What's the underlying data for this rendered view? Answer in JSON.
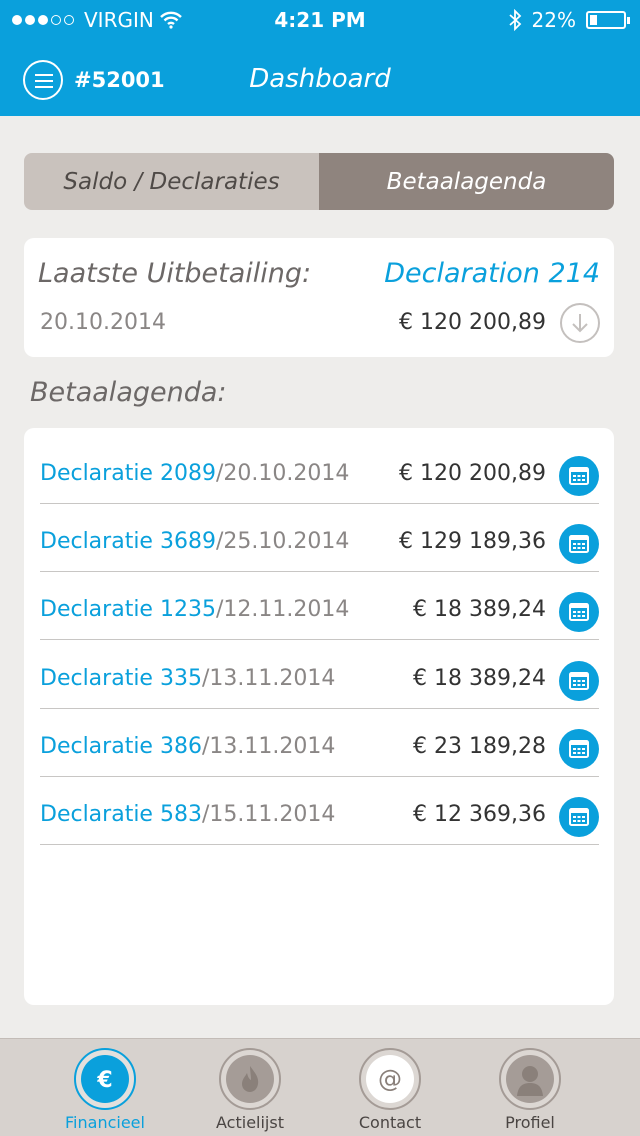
{
  "status_bar": {
    "carrier": "VIRGIN",
    "time": "4:21 PM",
    "battery": "22%"
  },
  "header": {
    "account_id": "#52001",
    "title": "Dashboard"
  },
  "segment": {
    "tab1": "Saldo / Declaraties",
    "tab2": "Betaalagenda",
    "active": "Betaalagenda"
  },
  "last_payout": {
    "label": "Laatste Uitbetailing:",
    "link": "Declaration 214",
    "date": "20.10.2014",
    "amount": "€ 120 200,89"
  },
  "section_heading": "Betaalagenda:",
  "payments": [
    {
      "name": "Declaratie 2089",
      "date": "/20.10.2014",
      "amount": "€ 120 200,89"
    },
    {
      "name": "Declaratie 3689",
      "date": "/25.10.2014",
      "amount": "€ 129 189,36"
    },
    {
      "name": "Declaratie 1235",
      "date": "/12.11.2014",
      "amount": "€ 18 389,24"
    },
    {
      "name": "Declaratie 335",
      "date": "/13.11.2014",
      "amount": "€ 18 389,24"
    },
    {
      "name": "Declaratie 386",
      "date": "/13.11.2014",
      "amount": "€ 23 189,28"
    },
    {
      "name": "Declaratie 583",
      "date": "/15.11.2014",
      "amount": "€ 12 369,36"
    }
  ],
  "tabbar": {
    "items": [
      {
        "label": "Financieel",
        "icon": "euro-icon"
      },
      {
        "label": "Actielijst",
        "icon": "flame-icon"
      },
      {
        "label": "Contact",
        "icon": "at-icon"
      },
      {
        "label": "Profiel",
        "icon": "person-icon"
      }
    ],
    "active": "Financieel"
  },
  "colors": {
    "accent": "#0aa0dc",
    "segment_active": "#8f847e",
    "segment_inactive": "#c9c2bd",
    "background": "#eeedeb"
  }
}
